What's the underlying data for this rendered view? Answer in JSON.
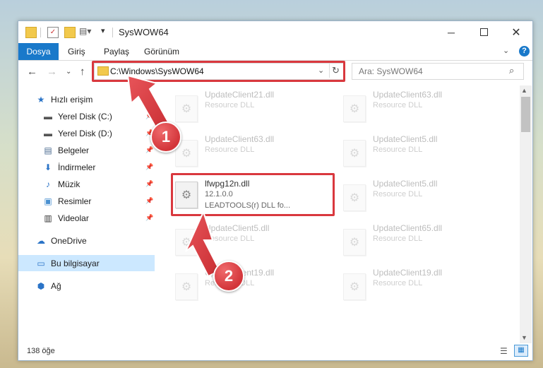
{
  "window": {
    "title": "SysWOW64"
  },
  "ribbon": {
    "tabs": [
      "Dosya",
      "Giriş",
      "Paylaş",
      "Görünüm"
    ]
  },
  "address": {
    "path": "C:\\Windows\\SysWOW64"
  },
  "search": {
    "placeholder": "Ara: SysWOW64"
  },
  "sidebar": {
    "items": [
      {
        "label": "Hızlı erişim",
        "icon": "star-icon",
        "pinned": false
      },
      {
        "label": "Yerel Disk (C:)",
        "icon": "drive-icon",
        "pinned": true
      },
      {
        "label": "Yerel Disk (D:)",
        "icon": "drive-icon",
        "pinned": true
      },
      {
        "label": "Belgeler",
        "icon": "documents-icon",
        "pinned": true
      },
      {
        "label": "İndirmeler",
        "icon": "downloads-icon",
        "pinned": true
      },
      {
        "label": "Müzik",
        "icon": "music-icon",
        "pinned": true
      },
      {
        "label": "Resimler",
        "icon": "pictures-icon",
        "pinned": true
      },
      {
        "label": "Videolar",
        "icon": "videos-icon",
        "pinned": true
      },
      {
        "label": "OneDrive",
        "icon": "cloud-icon",
        "pinned": false
      },
      {
        "label": "Bu bilgisayar",
        "icon": "computer-icon",
        "pinned": false,
        "selected": true
      },
      {
        "label": "Ağ",
        "icon": "network-icon",
        "pinned": false
      }
    ]
  },
  "files": {
    "left": [
      {
        "name": "UpdateClient21.dll",
        "desc": "Resource DLL"
      },
      {
        "name": "UpdateClient63.dll",
        "desc": "Resource DLL"
      },
      {
        "name": "lfwpg12n.dll",
        "version": "12.1.0.0",
        "desc": "LEADTOOLS(r) DLL fo..."
      },
      {
        "name": "UpdateClient5.dll",
        "desc": "Resource DLL"
      },
      {
        "name": "UpdateClient19.dll",
        "desc": "Resource DLL"
      }
    ],
    "right": [
      {
        "name": "UpdateClient63.dll",
        "desc": "Resource DLL"
      },
      {
        "name": "UpdateClient5.dll",
        "desc": "Resource DLL"
      },
      {
        "name": "UpdateClient5.dll",
        "desc": "Resource DLL"
      },
      {
        "name": "UpdateClient65.dll",
        "desc": "Resource DLL"
      },
      {
        "name": "UpdateClient19.dll",
        "desc": "Resource DLL"
      }
    ]
  },
  "status": {
    "count": "138 öğe"
  },
  "callouts": [
    "1",
    "2"
  ],
  "colors": {
    "accent": "#1979ca",
    "highlight": "#d9383e",
    "selection": "#cce8ff"
  }
}
